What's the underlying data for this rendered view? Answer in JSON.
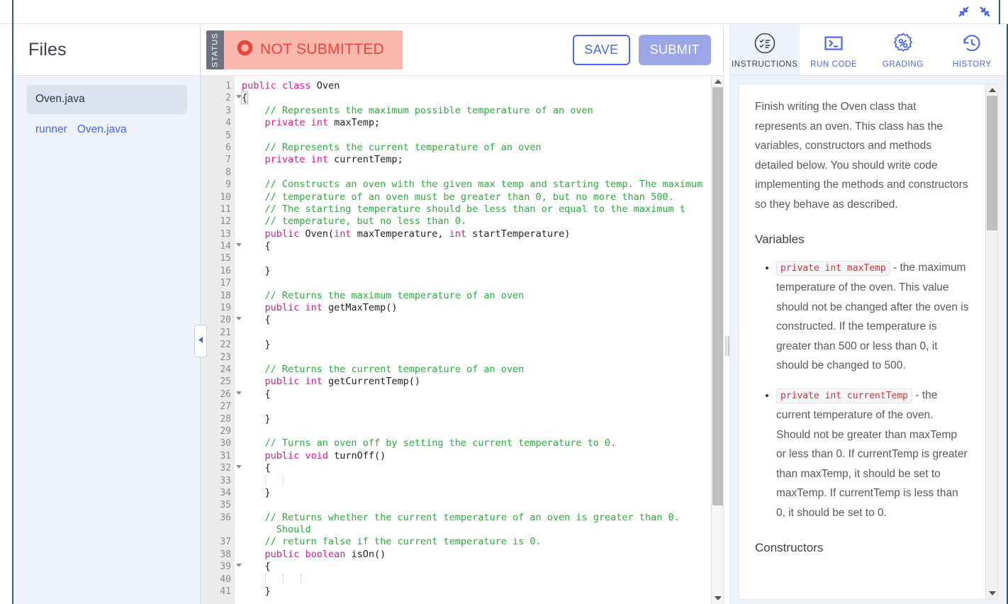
{
  "window": {
    "icons": [
      {
        "name": "collapse-left-icon",
        "glyph": "⬋"
      },
      {
        "name": "collapse-right-icon",
        "glyph": "⬊"
      }
    ]
  },
  "files_panel": {
    "title": "Files",
    "items": [
      {
        "label": "Oven.java",
        "active": true
      },
      {
        "label": "runner",
        "label2": "Oven.java",
        "active": false
      }
    ]
  },
  "toolbar": {
    "status_tag": "STATUS",
    "status_text": "NOT SUBMITTED",
    "status_icon": "circle-outline-icon",
    "status_color": "#e8453c",
    "status_bg": "#f9b8ab",
    "save_label": "SAVE",
    "submit_label": "SUBMIT"
  },
  "editor": {
    "filename": "Oven.java",
    "lines": [
      {
        "n": 1,
        "fold": false,
        "text": "public class Oven",
        "type": "decl"
      },
      {
        "n": 2,
        "fold": true,
        "text": "{",
        "type": "brace-match"
      },
      {
        "n": 3,
        "fold": false,
        "text": "    // Represents the maximum possible temperature of an oven",
        "type": "comment"
      },
      {
        "n": 4,
        "fold": false,
        "text": "    private int maxTemp;",
        "type": "decl"
      },
      {
        "n": 5,
        "fold": false,
        "text": "",
        "type": "blank"
      },
      {
        "n": 6,
        "fold": false,
        "text": "    // Represents the current temperature of an oven",
        "type": "comment"
      },
      {
        "n": 7,
        "fold": false,
        "text": "    private int currentTemp;",
        "type": "decl"
      },
      {
        "n": 8,
        "fold": false,
        "text": "",
        "type": "blank"
      },
      {
        "n": 9,
        "fold": false,
        "text": "    // Constructs an oven with the given max temp and starting temp. The maximum",
        "type": "comment"
      },
      {
        "n": 10,
        "fold": false,
        "text": "    // temperature of an oven must be greater than 0, but no more than 500.",
        "type": "comment"
      },
      {
        "n": 11,
        "fold": false,
        "text": "    // The starting temperature should be less than or equal to the maximum t",
        "type": "comment"
      },
      {
        "n": 12,
        "fold": false,
        "text": "    // temperature, but no less than 0.",
        "type": "comment"
      },
      {
        "n": 13,
        "fold": false,
        "text": "    public Oven(int maxTemperature, int startTemperature)",
        "type": "decl"
      },
      {
        "n": 14,
        "fold": true,
        "text": "    {",
        "type": "plain"
      },
      {
        "n": 15,
        "fold": false,
        "text": "",
        "type": "blank"
      },
      {
        "n": 16,
        "fold": false,
        "text": "    }",
        "type": "plain"
      },
      {
        "n": 17,
        "fold": false,
        "text": "",
        "type": "blank"
      },
      {
        "n": 18,
        "fold": false,
        "text": "    // Returns the maximum temperature of an oven",
        "type": "comment"
      },
      {
        "n": 19,
        "fold": false,
        "text": "    public int getMaxTemp()",
        "type": "decl"
      },
      {
        "n": 20,
        "fold": true,
        "text": "    {",
        "type": "plain"
      },
      {
        "n": 21,
        "fold": false,
        "text": "",
        "type": "blank"
      },
      {
        "n": 22,
        "fold": false,
        "text": "    }",
        "type": "plain"
      },
      {
        "n": 23,
        "fold": false,
        "text": "",
        "type": "blank"
      },
      {
        "n": 24,
        "fold": false,
        "text": "    // Returns the current temperature of an oven",
        "type": "comment"
      },
      {
        "n": 25,
        "fold": false,
        "text": "    public int getCurrentTemp()",
        "type": "decl"
      },
      {
        "n": 26,
        "fold": true,
        "text": "    {",
        "type": "plain"
      },
      {
        "n": 27,
        "fold": false,
        "text": "",
        "type": "blank"
      },
      {
        "n": 28,
        "fold": false,
        "text": "    }",
        "type": "plain"
      },
      {
        "n": 29,
        "fold": false,
        "text": "",
        "type": "blank"
      },
      {
        "n": 30,
        "fold": false,
        "text": "    // Turns an oven off by setting the current temperature to 0.",
        "type": "comment"
      },
      {
        "n": 31,
        "fold": false,
        "text": "    public void turnOff()",
        "type": "decl"
      },
      {
        "n": 32,
        "fold": true,
        "text": "    {",
        "type": "plain"
      },
      {
        "n": 33,
        "fold": false,
        "text": "",
        "type": "indent2"
      },
      {
        "n": 34,
        "fold": false,
        "text": "    }",
        "type": "plain"
      },
      {
        "n": 35,
        "fold": false,
        "text": "",
        "type": "blank"
      },
      {
        "n": 36,
        "fold": false,
        "text": "    // Returns whether the current temperature of an oven is greater than 0.\n      Should",
        "type": "comment-wrap"
      },
      {
        "n": 37,
        "fold": false,
        "text": "    // return false if the current temperature is 0.",
        "type": "comment"
      },
      {
        "n": 38,
        "fold": false,
        "text": "    public boolean isOn()",
        "type": "decl"
      },
      {
        "n": 39,
        "fold": true,
        "text": "    {",
        "type": "plain"
      },
      {
        "n": 40,
        "fold": false,
        "text": "",
        "type": "indent3"
      },
      {
        "n": 41,
        "fold": false,
        "text": "    }",
        "type": "plain"
      }
    ]
  },
  "right_panel": {
    "tabs": [
      {
        "label": "INSTRUCTIONS",
        "icon": "checklist-circle-icon",
        "active": true
      },
      {
        "label": "RUN CODE",
        "icon": "terminal-icon",
        "active": false
      },
      {
        "label": "GRADING",
        "icon": "percent-badge-icon",
        "active": false
      },
      {
        "label": "HISTORY",
        "icon": "clock-revert-icon",
        "active": false
      }
    ],
    "instructions": {
      "intro": "Finish writing the Oven class that represents an oven. This class has the variables, constructors and methods detailed below. You should write code implementing the methods and constructors so they behave as described.",
      "variables_heading": "Variables",
      "variables": [
        {
          "code": "private int maxTemp",
          "desc": " - the maximum temperature of the oven. This value should not be changed after the oven is constructed. If the temperature is greater than 500 or less than 0, it should be changed to 500."
        },
        {
          "code": "private int currentTemp",
          "desc": " - the current temperature of the oven. Should not be greater than maxTemp or less than 0. If currentTemp is greater than maxTemp, it should be set to maxTemp. If currentTemp is less than 0, it should be set to 0."
        }
      ],
      "constructors_heading": "Constructors"
    }
  }
}
